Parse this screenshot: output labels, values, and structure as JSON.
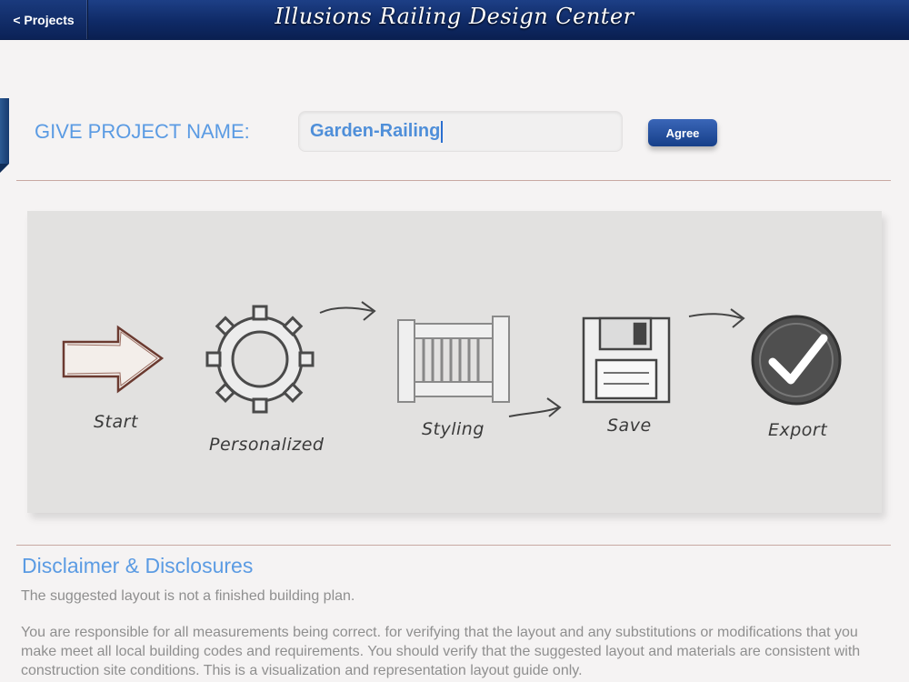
{
  "header": {
    "back_label": "< Projects",
    "title": "Illusions Railing Design Center"
  },
  "project_form": {
    "label": "GIVE PROJECT NAME:",
    "value": "Garden-Railing",
    "agree_label": "Agree"
  },
  "workflow": {
    "steps": [
      "Start",
      "Personalized",
      "Styling",
      "Save",
      "Export"
    ]
  },
  "disclaimer": {
    "title": "Disclaimer & Disclosures",
    "paragraph1": "The suggested layout is not a finished building plan.",
    "paragraph2": "You are responsible for all measurements being correct. for verifying that the layout and any substitutions or modifications that you make meet all local building codes and requirements. You should verify that the suggested layout and materials are consistent with construction site conditions. This is a visualization and representation layout guide only."
  },
  "colors": {
    "header_bg": "#0f2a66",
    "accent_blue": "#5b9be3",
    "button_blue": "#1f4a97"
  }
}
